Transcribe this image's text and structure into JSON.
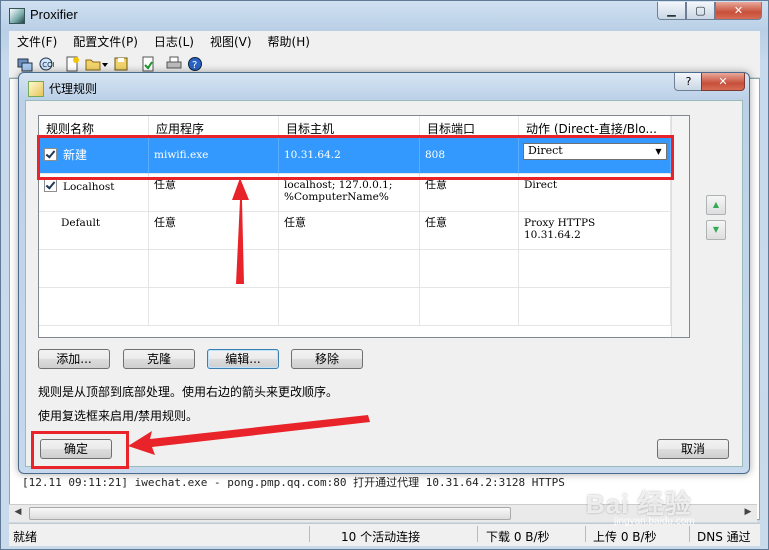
{
  "window": {
    "title": "Proxifier"
  },
  "window_controls": {
    "minimize": "▁",
    "maximize": "▢",
    "close": "✕"
  },
  "menu": [
    "文件(F)",
    "配置文件(P)",
    "日志(L)",
    "视图(V)",
    "帮助(H)"
  ],
  "toolbar": {
    "icons": [
      "profile-icon",
      "proxy-servers-icon",
      "new-profile-icon",
      "open-profile-icon",
      "dropdown-arrow-icon",
      "save-icon",
      "rules-icon",
      "print-icon",
      "help-icon"
    ]
  },
  "log": {
    "line": "[12.11 09:11:21] iwechat.exe - pong.pmp.qq.com:80 打开通过代理 10.31.64.2:3128 HTTPS"
  },
  "statusbar": {
    "ready": "就绪",
    "connections": "10 个活动连接",
    "download": "下载 0 B/秒",
    "upload": "上传 0 B/秒",
    "dns": "DNS 通过"
  },
  "dialog": {
    "title": "代理规则",
    "help_label": "?",
    "close_label": "✕",
    "columns": [
      "规则名称",
      "应用程序",
      "目标主机",
      "目标端口",
      "动作 (Direct-直接/Blo..."
    ],
    "rows": [
      {
        "name": "新建",
        "checked": true,
        "app": "miwifi.exe",
        "host": "10.31.64.2",
        "port": "808",
        "action": "Direct",
        "selected": true
      },
      {
        "name": "Localhost",
        "checked": true,
        "app": "任意",
        "host_line1": "localhost; 127.0.0.1;",
        "host_line2": "%ComputerName%",
        "port": "任意",
        "action": "Direct"
      },
      {
        "name": "Default",
        "checked": false,
        "app": "任意",
        "host": "任意",
        "port": "任意",
        "action_line1": "Proxy HTTPS",
        "action_line2": "10.31.64.2"
      }
    ],
    "buttons": {
      "add": "添加...",
      "clone": "克隆",
      "edit": "编辑...",
      "remove": "移除",
      "ok": "确定",
      "cancel": "取消"
    },
    "move_up": "▲",
    "move_down": "▼",
    "note1": "规则是从顶部到底部处理。使用右边的箭头来更改顺序。",
    "note2": "使用复选框来启用/禁用规则。"
  },
  "watermark": {
    "text": "Bai 经验",
    "sub": "jingyan.baidu.com"
  },
  "annotation_color": "#e8242a"
}
